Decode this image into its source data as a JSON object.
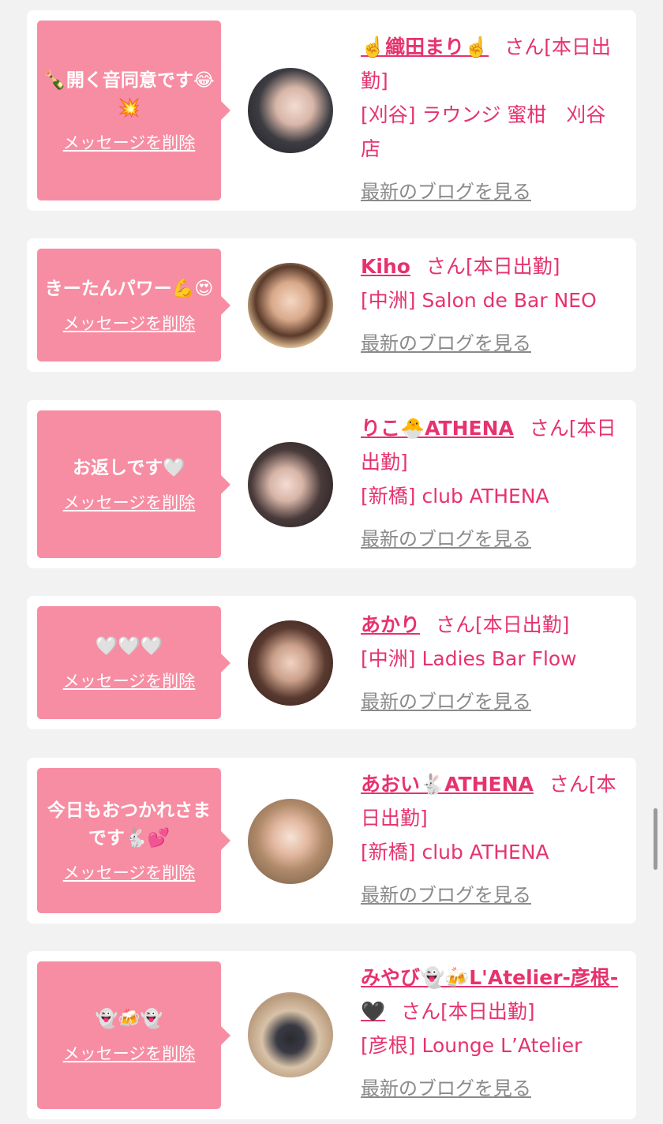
{
  "san_label": "さん",
  "delete_label": "メッセージを削除",
  "blog_label": "最新のブログを見る",
  "colors": {
    "bubble": "#f78da3",
    "name": "#e6336d",
    "blog_link": "#8a8a8a",
    "background": "#f2f2f2"
  },
  "items": [
    {
      "message": "🍾開く音同意です😂💥",
      "name": "☝️織田まり☝️",
      "status": "[本日出勤]",
      "shop": "[刈谷] ラウンジ 蜜柑　刈谷店"
    },
    {
      "message": "きーたんパワー💪😍",
      "name": "Kiho",
      "status": "[本日出勤]",
      "shop": "[中洲] Salon de Bar NEO"
    },
    {
      "message": "お返しです🤍",
      "name": "りこ🐣ATHENA",
      "status": "[本日出勤]",
      "shop": "[新橋] club ATHENA"
    },
    {
      "message": "🤍🤍🤍",
      "name": "あかり",
      "status": "[本日出勤]",
      "shop": "[中洲] Ladies Bar Flow"
    },
    {
      "message": "今日もおつかれさまです🐇💕",
      "name": "あおい🐇ATHENA",
      "status": "[本日出勤]",
      "shop": "[新橋] club ATHENA"
    },
    {
      "message": "👻🍻👻",
      "name": "みやび👻🍻L'Atelier-彦根-🖤",
      "status": "[本日出勤]",
      "shop": "[彦根] Lounge L’Atelier"
    }
  ]
}
